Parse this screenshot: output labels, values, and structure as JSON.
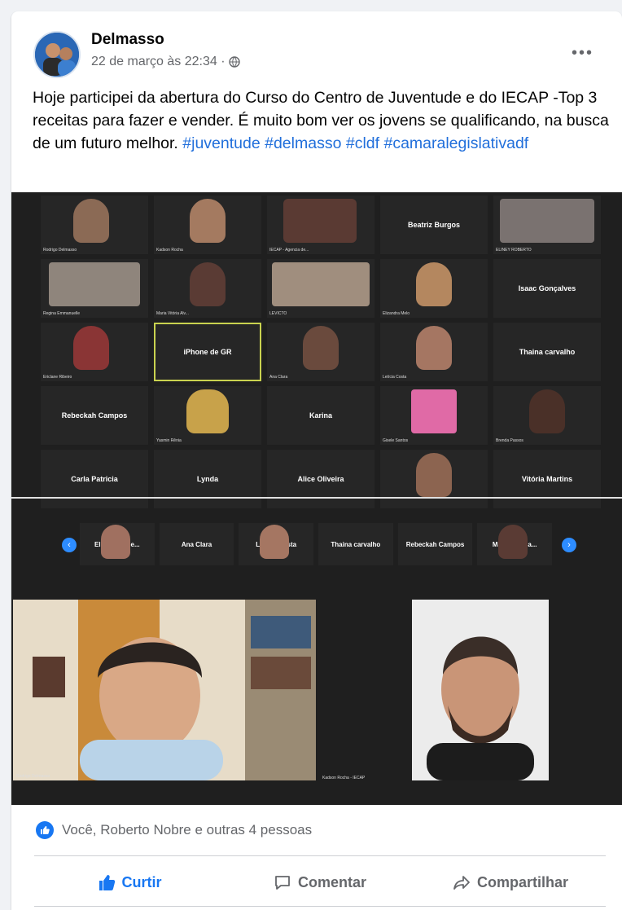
{
  "post": {
    "author": "Delmasso",
    "timestamp": "22 de março às 22:34 ·",
    "privacy_icon": "globe-icon",
    "more_label": "•••",
    "text_main": "Hoje participei da abertura do Curso do Centro de Juventude e do IECAP -Top 3 receitas para fazer e vender. É muito bom ver os jovens se qualificando, na busca de um futuro melhor. ",
    "hashtags": [
      "#juventude",
      "#delmasso",
      "#cldf",
      "#camaralegislativadf"
    ]
  },
  "video_grid": {
    "tiles": [
      {
        "label": "",
        "caption": "Rodrigo Delmasso",
        "video": true
      },
      {
        "label": "",
        "caption": "Kadson Rocha",
        "video": true
      },
      {
        "label": "",
        "caption": "IECAP - Agencia de...",
        "video": true
      },
      {
        "label": "Beatriz Burgos",
        "caption": "",
        "video": false
      },
      {
        "label": "",
        "caption": "ELINEY ROBERTO",
        "video": true
      },
      {
        "label": "",
        "caption": "Regina Emmanuelle",
        "video": true
      },
      {
        "label": "",
        "caption": "Maria Vitória Alv...",
        "video": true
      },
      {
        "label": "",
        "caption": "LEVICTO",
        "video": true
      },
      {
        "label": "",
        "caption": "Elizandra Melo",
        "video": true
      },
      {
        "label": "Isaac Gonçalves",
        "caption": "",
        "video": false
      },
      {
        "label": "",
        "caption": "Ericlane Ribeiro",
        "video": true
      },
      {
        "label": "iPhone de GR",
        "caption": "",
        "video": false,
        "selected": true
      },
      {
        "label": "",
        "caption": "Ana Clara",
        "video": true
      },
      {
        "label": "",
        "caption": "Letícia Costa",
        "video": true
      },
      {
        "label": "Thaina carvalho",
        "caption": "",
        "video": false
      },
      {
        "label": "Rebeckah Campos",
        "caption": "",
        "video": false
      },
      {
        "label": "",
        "caption": "Yasmin Rênia",
        "video": true
      },
      {
        "label": "Karina",
        "caption": "",
        "video": false
      },
      {
        "label": "",
        "caption": "Gisele Santos",
        "video": true
      },
      {
        "label": "",
        "caption": "Brenda Passos",
        "video": true
      },
      {
        "label": "Carla Patricia",
        "caption": "",
        "video": false
      },
      {
        "label": "Lynda",
        "caption": "",
        "video": false
      },
      {
        "label": "Alice Oliveira",
        "caption": "",
        "video": false
      },
      {
        "label": "",
        "caption": "",
        "video": true
      },
      {
        "label": "Vitória Martins",
        "caption": "",
        "video": false
      }
    ]
  },
  "strip": {
    "tiles": [
      {
        "label": "",
        "caption": "Elizandra Me..."
      },
      {
        "label": "Ana Clara",
        "caption": ""
      },
      {
        "label": "",
        "caption": "Letícia Costa"
      },
      {
        "label": "Thaina carvalho",
        "caption": ""
      },
      {
        "label": "Rebeckah Campos",
        "caption": ""
      },
      {
        "label": "",
        "caption": "Maria Vitória..."
      }
    ]
  },
  "speakers": {
    "left_caption": "Rodrigo Delmasso",
    "right_caption": "Kadson Rocha - IECAP"
  },
  "reactions": {
    "text": "Você, Roberto Nobre e outras 4 pessoas"
  },
  "actions": {
    "like": "Curtir",
    "comment": "Comentar",
    "share": "Compartilhar"
  },
  "colors": {
    "link": "#216fdb",
    "like_blue": "#1877f2",
    "secondary_text": "#65676b"
  }
}
